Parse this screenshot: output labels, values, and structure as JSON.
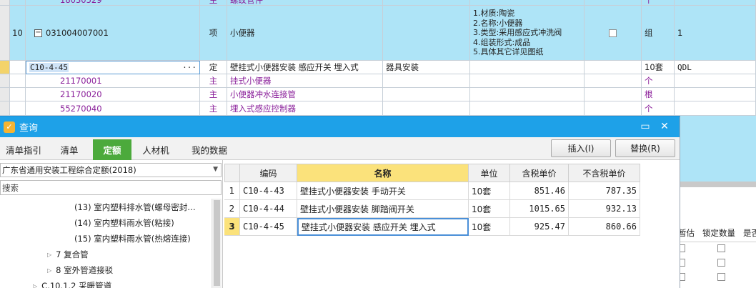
{
  "background_rows": [
    {
      "code": "18030529",
      "type": "主",
      "name": "螺纹管件",
      "unit": "个",
      "purple": true
    },
    {
      "row_no": "10",
      "code": "031004007001",
      "type": "项",
      "name": "小便器",
      "features": [
        "1.材质:陶瓷",
        "2.名称:小便器",
        "3.类型:采用感应式冲洗阀",
        "4.组装形式:成品",
        "5.具体其它详见图纸"
      ],
      "unit": "组",
      "qty": "1"
    },
    {
      "code": "C10-4-45",
      "ellipsis": "···",
      "type": "定",
      "name": "壁挂式小便器安装 感应开关 埋入式",
      "category": "器具安装",
      "unit": "10套",
      "extra": "QDL"
    },
    {
      "code": "21170001",
      "type": "主",
      "name": "挂式小便器",
      "unit": "个",
      "purple": true
    },
    {
      "code": "21170020",
      "type": "主",
      "name": "小便器冲水连接管",
      "unit": "根",
      "purple": true
    },
    {
      "code": "55270040",
      "type": "主",
      "name": "埋入式感应控制器",
      "unit": "个",
      "purple": true
    }
  ],
  "dialog": {
    "title": "查询",
    "logo_glyph": "✓",
    "minimize_glyph": "▭",
    "close_glyph": "✕",
    "tabs": [
      "清单指引",
      "清单",
      "定额",
      "人材机",
      "我的数据"
    ],
    "active_tab": 2,
    "insert_label": "插入(I)",
    "replace_label": "替换(R)",
    "rulebook": "广东省通用安装工程综合定额(2018)",
    "search_placeholder": "搜索",
    "tree": [
      {
        "label": "(13) 室内塑料排水管(螺母密封…"
      },
      {
        "label": "(14) 室内塑料雨水管(粘接)"
      },
      {
        "label": "(15) 室内塑料雨水管(热熔连接)"
      },
      {
        "label": "7 复合管",
        "expander": "▷"
      },
      {
        "label": "8 室外管道接驳",
        "expander": "▷"
      },
      {
        "label": "C.10.1.2 采暖管道",
        "expander": "▷"
      }
    ],
    "grid": {
      "headers": [
        "",
        "编码",
        "名称",
        "单位",
        "含税单价",
        "不含税单价"
      ],
      "rows": [
        {
          "idx": "1",
          "code": "C10-4-43",
          "name": "壁挂式小便器安装 手动开关",
          "unit": "10套",
          "tax_price": "851.46",
          "notax_price": "787.35"
        },
        {
          "idx": "2",
          "code": "C10-4-44",
          "name": "壁挂式小便器安装 脚踏阀开关",
          "unit": "10套",
          "tax_price": "1015.65",
          "notax_price": "932.13"
        },
        {
          "idx": "3",
          "code": "C10-4-45",
          "name": "壁挂式小便器安装 感应开关 埋入式",
          "unit": "10套",
          "tax_price": "925.47",
          "notax_price": "860.66"
        }
      ],
      "selected_row": 2
    }
  },
  "right_columns": [
    "暂估",
    "锁定数量",
    "是否"
  ],
  "colors": {
    "title_blue": "#1ea1e8",
    "tab_green": "#4caa3c",
    "row_blue": "#aee4f7",
    "header_yellow": "#fbe27b",
    "purple_text": "#8a1f9a"
  }
}
